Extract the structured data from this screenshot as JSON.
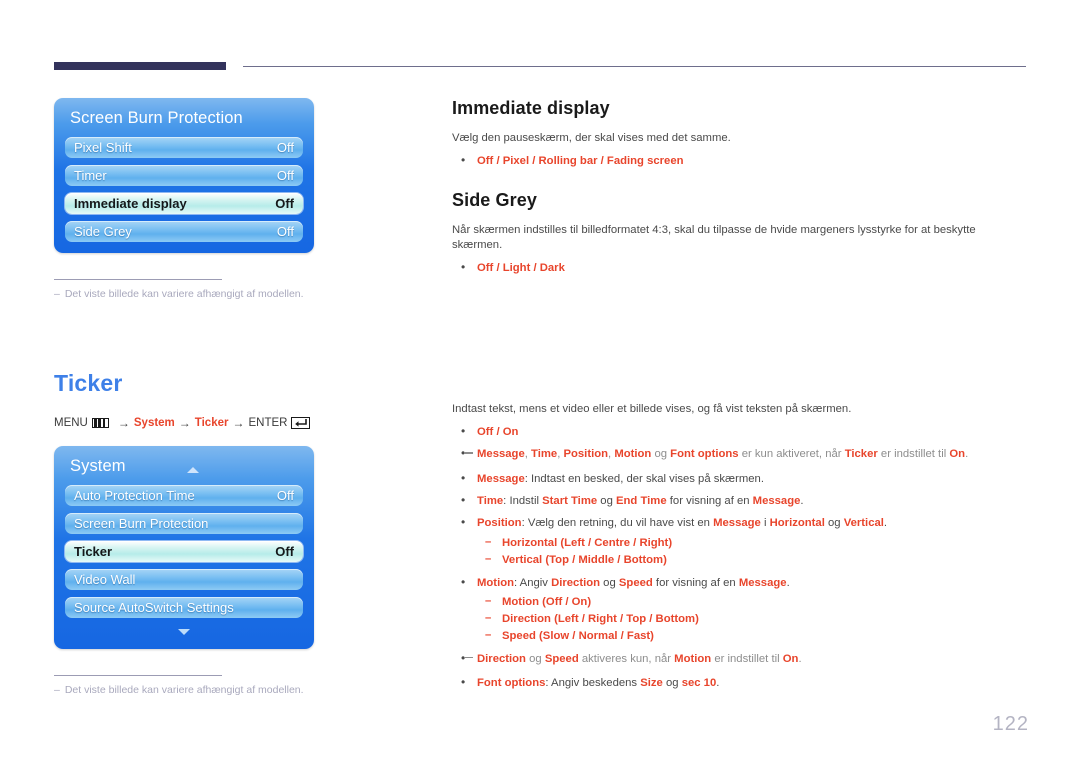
{
  "page": {
    "number": "122"
  },
  "header": {
    "rule": "decorative-rule"
  },
  "osd_panels": [
    {
      "id": "screen-burn-protection",
      "title": "Screen Burn Protection",
      "has_up_caret": false,
      "has_down_caret": false,
      "rows": [
        {
          "label": "Pixel Shift",
          "value": "Off",
          "selected": false
        },
        {
          "label": "Timer",
          "value": "Off",
          "selected": false
        },
        {
          "label": "Immediate display",
          "value": "Off",
          "selected": true
        },
        {
          "label": "Side Grey",
          "value": "Off",
          "selected": false
        }
      ]
    },
    {
      "id": "system",
      "title": "System",
      "has_up_caret": true,
      "has_down_caret": true,
      "rows": [
        {
          "label": "Auto Protection Time",
          "value": "Off",
          "selected": false
        },
        {
          "label": "Screen Burn Protection",
          "value": "",
          "selected": false
        },
        {
          "label": "Ticker",
          "value": "Off",
          "selected": true
        },
        {
          "label": "Video Wall",
          "value": "",
          "selected": false
        },
        {
          "label": "Source AutoSwitch Settings",
          "value": "",
          "selected": false
        }
      ]
    }
  ],
  "notes": {
    "dash": "–",
    "text": "Det viste billede kan variere afhængigt af modellen."
  },
  "ticker": {
    "heading": "Ticker",
    "menu_path": {
      "menu_label": "MENU",
      "menu_icon": "menu-grid-icon",
      "arrow": "→",
      "step1": "System",
      "step2": "Ticker",
      "enter_label": "ENTER",
      "enter_icon": "enter-key-icon"
    }
  },
  "sections": [
    {
      "id": "immediate-display",
      "title": "Immediate display",
      "body": "Vælg den pauseskærm, der skal vises med det samme.",
      "options": "Off / Pixel / Rolling bar / Fading screen"
    },
    {
      "id": "side-grey",
      "title": "Side Grey",
      "body": "Når skærmen indstilles til billedformatet 4:3, skal du tilpasse de hvide margeners lysstyrke for at beskytte skærmen.",
      "options": "Off / Light / Dark"
    }
  ],
  "ticker_content": {
    "intro": "Indtast tekst, mens et video eller et billede vises, og få vist teksten på skærmen.",
    "b1_options": "Off / On",
    "note1": {
      "a": "Message",
      "b": "Time",
      "c": "Position",
      "d": "Motion",
      "og1": " og ",
      "e": "Font options",
      "mid": " er kun aktiveret, når ",
      "f": "Ticker",
      "tail": " er indstillet til ",
      "g": "On",
      "period": "."
    },
    "b_message": {
      "term": "Message",
      "rest": ": Indtast en besked, der skal vises på skærmen."
    },
    "b_time": {
      "term": "Time",
      "r1": ": Indstil ",
      "s1": "Start Time",
      "r2": " og ",
      "s2": "End Time",
      "r3": " for visning af en ",
      "s3": "Message",
      "r4": "."
    },
    "b_position": {
      "term": "Position",
      "r1": ": Vælg den retning, du vil have vist en ",
      "s1": "Message",
      "r2": " i ",
      "s2": "Horizontal",
      "r3": " og ",
      "s3": "Vertical",
      "r4": "."
    },
    "sub_horizontal": {
      "term": "Horizontal",
      "values": "(Left / Centre / Right)"
    },
    "sub_vertical": {
      "term": "Vertical",
      "values": "(Top / Middle / Bottom)"
    },
    "b_motion": {
      "term": "Motion",
      "r1": ": Angiv ",
      "s1": "Direction",
      "r2": " og ",
      "s2": "Speed",
      "r3": " for visning af en ",
      "s3": "Message",
      "r4": "."
    },
    "sub_motion": {
      "term": "Motion",
      "values": "(Off / On)"
    },
    "sub_direction": {
      "term": "Direction",
      "values": "(Left / Right / Top / Bottom)"
    },
    "sub_speed": {
      "term": "Speed",
      "values": "(Slow / Normal / Fast)"
    },
    "note2": {
      "a": "Direction",
      "og": " og ",
      "b": "Speed",
      "mid": " aktiveres kun, når ",
      "c": "Motion",
      "tail": " er indstillet til ",
      "d": "On",
      "period": "."
    },
    "b_font": {
      "term": "Font options",
      "r1": ": Angiv beskedens ",
      "s1": "Size",
      "r2": " og ",
      "s2": "sec 10",
      "r3": "."
    }
  },
  "colors": {
    "accent_red": "#e8452c",
    "heading_blue": "#3e80e8",
    "rule_navy": "#33335c",
    "osd_blue": "#1f74e6",
    "note_grey": "#a9a9bd"
  }
}
